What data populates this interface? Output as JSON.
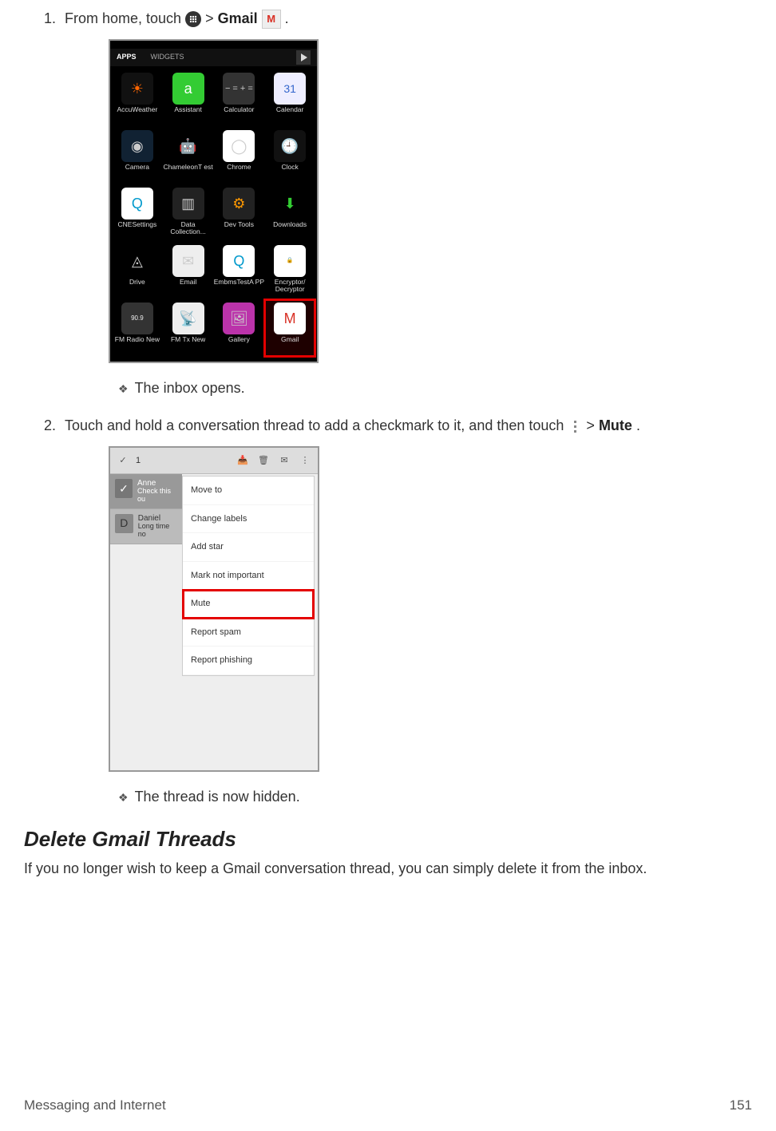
{
  "step1": {
    "prefix": "From home, touch ",
    "gt": " > ",
    "gmail_label": "Gmail",
    "suffix": "."
  },
  "note1": "The inbox opens.",
  "step2": {
    "prefix": "Touch and hold a conversation thread to add a checkmark to it, and then touch ",
    "gt": " > ",
    "mute_label": "Mute",
    "suffix": "."
  },
  "note2": "The thread is now hidden.",
  "screenshot1": {
    "tabs": {
      "apps": "APPS",
      "widgets": "WIDGETS"
    },
    "apps": [
      {
        "label": "AccuWeather",
        "cls": "i-accu",
        "glyph": "☀"
      },
      {
        "label": "Assistant",
        "cls": "i-assist",
        "glyph": "a"
      },
      {
        "label": "Calculator",
        "cls": "i-calc",
        "glyph": "− =\n+ ="
      },
      {
        "label": "Calendar",
        "cls": "i-cal",
        "glyph": "31"
      },
      {
        "label": "Camera",
        "cls": "i-cam",
        "glyph": "◉"
      },
      {
        "label": "ChameleonT\nest",
        "cls": "i-cham",
        "glyph": "🤖"
      },
      {
        "label": "Chrome",
        "cls": "i-chrome",
        "glyph": "◯"
      },
      {
        "label": "Clock",
        "cls": "i-clock",
        "glyph": "🕘"
      },
      {
        "label": "CNESettings",
        "cls": "i-cne",
        "glyph": "Q"
      },
      {
        "label": "Data\nCollection...",
        "cls": "i-data",
        "glyph": "▥"
      },
      {
        "label": "Dev Tools",
        "cls": "i-dev",
        "glyph": "⚙"
      },
      {
        "label": "Downloads",
        "cls": "i-down",
        "glyph": "⬇"
      },
      {
        "label": "Drive",
        "cls": "i-drive",
        "glyph": "◬"
      },
      {
        "label": "Email",
        "cls": "i-email",
        "glyph": "✉"
      },
      {
        "label": "EmbmsTestA\nPP",
        "cls": "i-embms",
        "glyph": "Q"
      },
      {
        "label": "Encryptor/\nDecryptor",
        "cls": "i-enc",
        "glyph": "🔒"
      },
      {
        "label": "FM Radio\nNew",
        "cls": "i-fmn",
        "glyph": "90.9"
      },
      {
        "label": "FM Tx New",
        "cls": "i-fmt",
        "glyph": "📡"
      },
      {
        "label": "Gallery",
        "cls": "i-gal",
        "glyph": "🖼"
      },
      {
        "label": "Gmail",
        "cls": "i-gmail",
        "glyph": "M",
        "highlight": true
      }
    ]
  },
  "screenshot2": {
    "selected_count": "1",
    "threads": [
      {
        "name": "Anne",
        "preview": "Check this ou",
        "selected": true,
        "avatar": "✓"
      },
      {
        "name": "Daniel",
        "preview": "Long time no",
        "selected": false,
        "avatar": "D"
      }
    ],
    "menu": [
      {
        "label": "Move to"
      },
      {
        "label": "Change labels"
      },
      {
        "label": "Add star"
      },
      {
        "label": "Mark not important"
      },
      {
        "label": "Mute",
        "highlight": true
      },
      {
        "label": "Report spam"
      },
      {
        "label": "Report phishing"
      }
    ]
  },
  "section": {
    "title": "Delete Gmail Threads",
    "body": "If you no longer wish to keep a Gmail conversation thread, you can simply delete it from the inbox."
  },
  "footer": {
    "left": "Messaging and Internet",
    "right": "151"
  }
}
